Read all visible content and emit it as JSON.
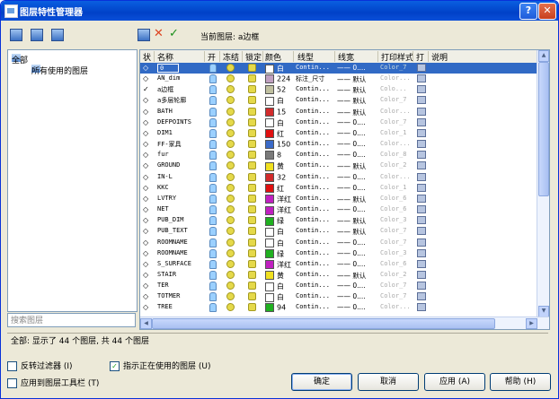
{
  "window": {
    "title": "图层特性管理器",
    "help": "?",
    "close": "✕"
  },
  "current_layer_text": "当前图层: a边框",
  "tree": {
    "root": "全部",
    "child": "所有使用的图层"
  },
  "search_placeholder": "搜索图层",
  "columns": [
    "状",
    "名称",
    "开",
    "冻结",
    "锁定",
    "颜色",
    "线型",
    "线宽",
    "打印样式",
    "打",
    "说明"
  ],
  "layers": [
    {
      "status": "◇",
      "name": "0",
      "color_hex": "#ffffff",
      "color": "白",
      "linetype": "Contin...",
      "lineweight": "—— 0....",
      "plotstyle": "Color_7",
      "selected": true
    },
    {
      "status": "◇",
      "name": "AN_dim",
      "color_hex": "#c0a0c0",
      "color": "224",
      "linetype": "标注_尺寸",
      "lineweight": "—— 默认",
      "plotstyle": "Color..."
    },
    {
      "status": "✓",
      "name": "a边框",
      "color_hex": "#c0c0a0",
      "color": "52",
      "linetype": "Contin...",
      "lineweight": "—— 默认",
      "plotstyle": "Colo..."
    },
    {
      "status": "◇",
      "name": "a多层轮廓",
      "color_hex": "#ffffff",
      "color": "白",
      "linetype": "Contin...",
      "lineweight": "—— 默认",
      "plotstyle": "Color_7"
    },
    {
      "status": "◇",
      "name": "BATH",
      "color_hex": "#d22b2b",
      "color": "15",
      "linetype": "Contin...",
      "lineweight": "—— 默认",
      "plotstyle": "Color..."
    },
    {
      "status": "◇",
      "name": "DEFPOINTS",
      "color_hex": "#ffffff",
      "color": "白",
      "linetype": "Contin...",
      "lineweight": "—— 0....",
      "plotstyle": "Color_7"
    },
    {
      "status": "◇",
      "name": "DIM1",
      "color_hex": "#e01010",
      "color": "红",
      "linetype": "Contin...",
      "lineweight": "—— 0....",
      "plotstyle": "Color_1"
    },
    {
      "status": "◇",
      "name": "FF-家具",
      "color_hex": "#3a6ac8",
      "color": "150",
      "linetype": "Contin...",
      "lineweight": "—— 0....",
      "plotstyle": "Color..."
    },
    {
      "status": "◇",
      "name": "fur",
      "color_hex": "#7a7a7a",
      "color": "8",
      "linetype": "Contin...",
      "lineweight": "—— 0....",
      "plotstyle": "Color_8"
    },
    {
      "status": "◇",
      "name": "GROUND",
      "color_hex": "#f0e020",
      "color": "黄",
      "linetype": "Contin...",
      "lineweight": "—— 默认",
      "plotstyle": "Color_2"
    },
    {
      "status": "◇",
      "name": "IN-L",
      "color_hex": "#d22b2b",
      "color": "32",
      "linetype": "Contin...",
      "lineweight": "—— 0....",
      "plotstyle": "Color..."
    },
    {
      "status": "◇",
      "name": "KKC",
      "color_hex": "#e01010",
      "color": "红",
      "linetype": "Contin...",
      "lineweight": "—— 0....",
      "plotstyle": "Color_1"
    },
    {
      "status": "◇",
      "name": "LVTRY",
      "color_hex": "#c020c0",
      "color": "洋红",
      "linetype": "Contin...",
      "lineweight": "—— 默认",
      "plotstyle": "Color_6"
    },
    {
      "status": "◇",
      "name": "NET",
      "color_hex": "#c020c0",
      "color": "洋红",
      "linetype": "Contin...",
      "lineweight": "—— 0....",
      "plotstyle": "Color_6"
    },
    {
      "status": "◇",
      "name": "PUB_DIM",
      "color_hex": "#20b020",
      "color": "绿",
      "linetype": "Contin...",
      "lineweight": "—— 默认",
      "plotstyle": "Color_3"
    },
    {
      "status": "◇",
      "name": "PUB_TEXT",
      "color_hex": "#ffffff",
      "color": "白",
      "linetype": "Contin...",
      "lineweight": "—— 默认",
      "plotstyle": "Color_7"
    },
    {
      "status": "◇",
      "name": "ROOMNAME",
      "color_hex": "#ffffff",
      "color": "白",
      "linetype": "Contin...",
      "lineweight": "—— 0....",
      "plotstyle": "Color_7"
    },
    {
      "status": "◇",
      "name": "ROOMNAME",
      "color_hex": "#20b020",
      "color": "绿",
      "linetype": "Contin...",
      "lineweight": "—— 0....",
      "plotstyle": "Color_3"
    },
    {
      "status": "◇",
      "name": "S_SURFACE",
      "color_hex": "#c020c0",
      "color": "洋红",
      "linetype": "Contin...",
      "lineweight": "—— 0....",
      "plotstyle": "Color_6"
    },
    {
      "status": "◇",
      "name": "STAIR",
      "color_hex": "#f0e020",
      "color": "黄",
      "linetype": "Contin...",
      "lineweight": "—— 默认",
      "plotstyle": "Color_2"
    },
    {
      "status": "◇",
      "name": "TER",
      "color_hex": "#ffffff",
      "color": "白",
      "linetype": "Contin...",
      "lineweight": "—— 0....",
      "plotstyle": "Color_7"
    },
    {
      "status": "◇",
      "name": "TOTMER",
      "color_hex": "#ffffff",
      "color": "白",
      "linetype": "Contin...",
      "lineweight": "—— 0....",
      "plotstyle": "Color_7"
    },
    {
      "status": "◇",
      "name": "TREE",
      "color_hex": "#20b020",
      "color": "94",
      "linetype": "Contin...",
      "lineweight": "—— 0....",
      "plotstyle": "Color..."
    }
  ],
  "status_text": "全部: 显示了 44 个图层, 共 44 个图层",
  "options": {
    "invert_filter": "反转过滤器 (I)",
    "apply_toolbar": "应用到图层工具栏 (T)",
    "show_in_use": "指示正在使用的图层 (U)"
  },
  "buttons": {
    "ok": "确定",
    "cancel": "取消",
    "apply": "应用 (A)",
    "help": "帮助 (H)"
  }
}
